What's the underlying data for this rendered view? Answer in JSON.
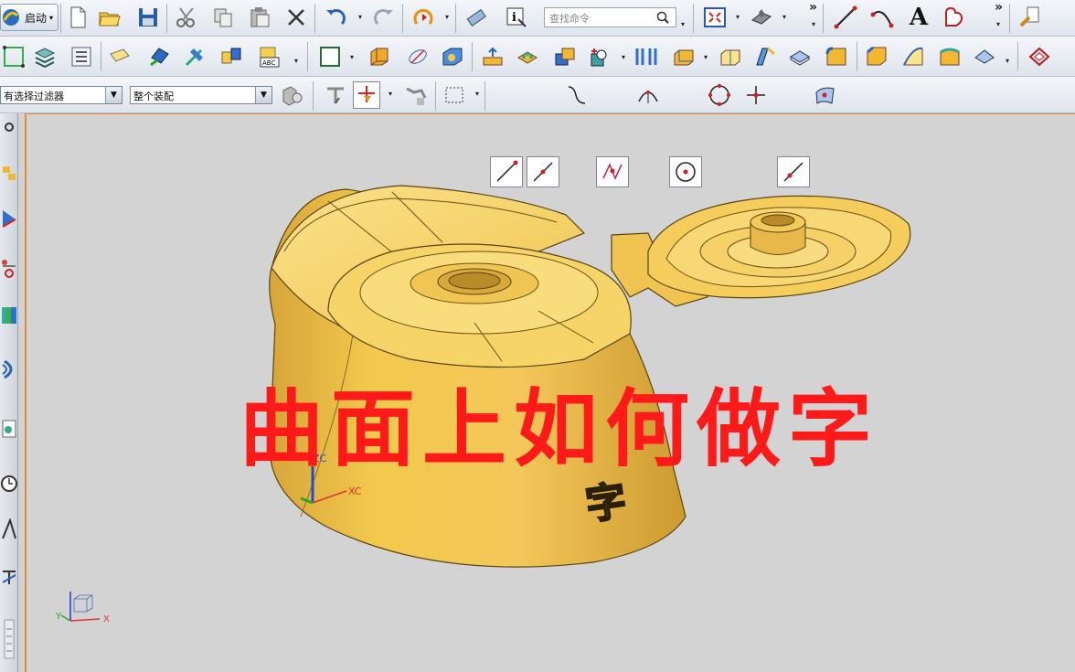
{
  "toolbar": {
    "start_label": "启动",
    "search_placeholder": "查找命令",
    "more_glyph": "»",
    "text_tool_label": "A"
  },
  "filters": {
    "selection_filter": "有选择过滤器",
    "assembly_scope": "整个装配"
  },
  "viewport": {
    "overlay_text": "曲面上如何做字",
    "embossed_char": "字",
    "axis_zc": "ZC",
    "axis_xc": "XC",
    "triad_x": "X",
    "triad_y": "Y"
  },
  "colors": {
    "background": "#d3d3d3",
    "model_fill": "#f2c94c",
    "overlay_text": "#ff1a1a",
    "view_border": "#e28a3a"
  }
}
